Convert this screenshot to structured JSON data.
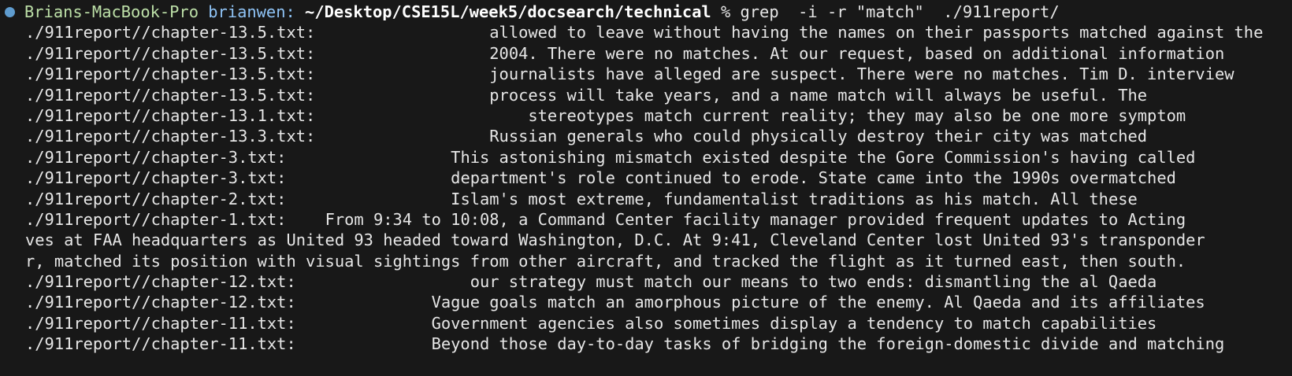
{
  "theme": {
    "background": "#181818",
    "text": "#e6e6e6",
    "host_color": "#bde0a8",
    "user_color": "#8fc3f5",
    "dot_color": "#5f9ccf"
  },
  "prompt": {
    "status_icon": "blue-dot-icon",
    "host": "Brians-MacBook-Pro",
    "user": "brianwen:",
    "path": "~/Desktop/CSE15L/week5/docsearch/technical",
    "symbol": "%",
    "command": "grep  -i -r \"match\"  ./911report/"
  },
  "output": [
    {
      "file": "./911report//chapter-13.5.txt:",
      "text": "                  allowed to leave without having the names on their passports matched against the"
    },
    {
      "file": "./911report//chapter-13.5.txt:",
      "text": "                  2004. There were no matches. At our request, based on additional information"
    },
    {
      "file": "./911report//chapter-13.5.txt:",
      "text": "                  journalists have alleged are suspect. There were no matches. Tim D. interview"
    },
    {
      "file": "./911report//chapter-13.5.txt:",
      "text": "                  process will take years, and a name match will always be useful. The"
    },
    {
      "file": "./911report//chapter-13.1.txt:",
      "text": "                      stereotypes match current reality; they may also be one more symptom"
    },
    {
      "file": "./911report//chapter-13.3.txt:",
      "text": "                  Russian generals who could physically destroy their city was matched"
    },
    {
      "file": "./911report//chapter-3.txt:",
      "text": "                 This astonishing mismatch existed despite the Gore Commission's having called"
    },
    {
      "file": "./911report//chapter-3.txt:",
      "text": "                 department's role continued to erode. State came into the 1990s overmatched"
    },
    {
      "file": "./911report//chapter-2.txt:",
      "text": "                 Islam's most extreme, fundamentalist traditions as his match. All these"
    },
    {
      "file": "./911report//chapter-1.txt:",
      "text": "    From 9:34 to 10:08, a Command Center facility manager provided frequent updates to Acting"
    },
    {
      "file": "",
      "text": "ves at FAA headquarters as United 93 headed toward Washington, D.C. At 9:41, Cleveland Center lost United 93's transponder"
    },
    {
      "file": "",
      "text": "r, matched its position with visual sightings from other aircraft, and tracked the flight as it turned east, then south."
    },
    {
      "file": "./911report//chapter-12.txt:",
      "text": "                  our strategy must match our means to two ends: dismantling the al Qaeda"
    },
    {
      "file": "./911report//chapter-12.txt:",
      "text": "              Vague goals match an amorphous picture of the enemy. Al Qaeda and its affiliates"
    },
    {
      "file": "./911report//chapter-11.txt:",
      "text": "              Government agencies also sometimes display a tendency to match capabilities"
    },
    {
      "file": "./911report//chapter-11.txt:",
      "text": "              Beyond those day-to-day tasks of bridging the foreign-domestic divide and matching"
    }
  ]
}
